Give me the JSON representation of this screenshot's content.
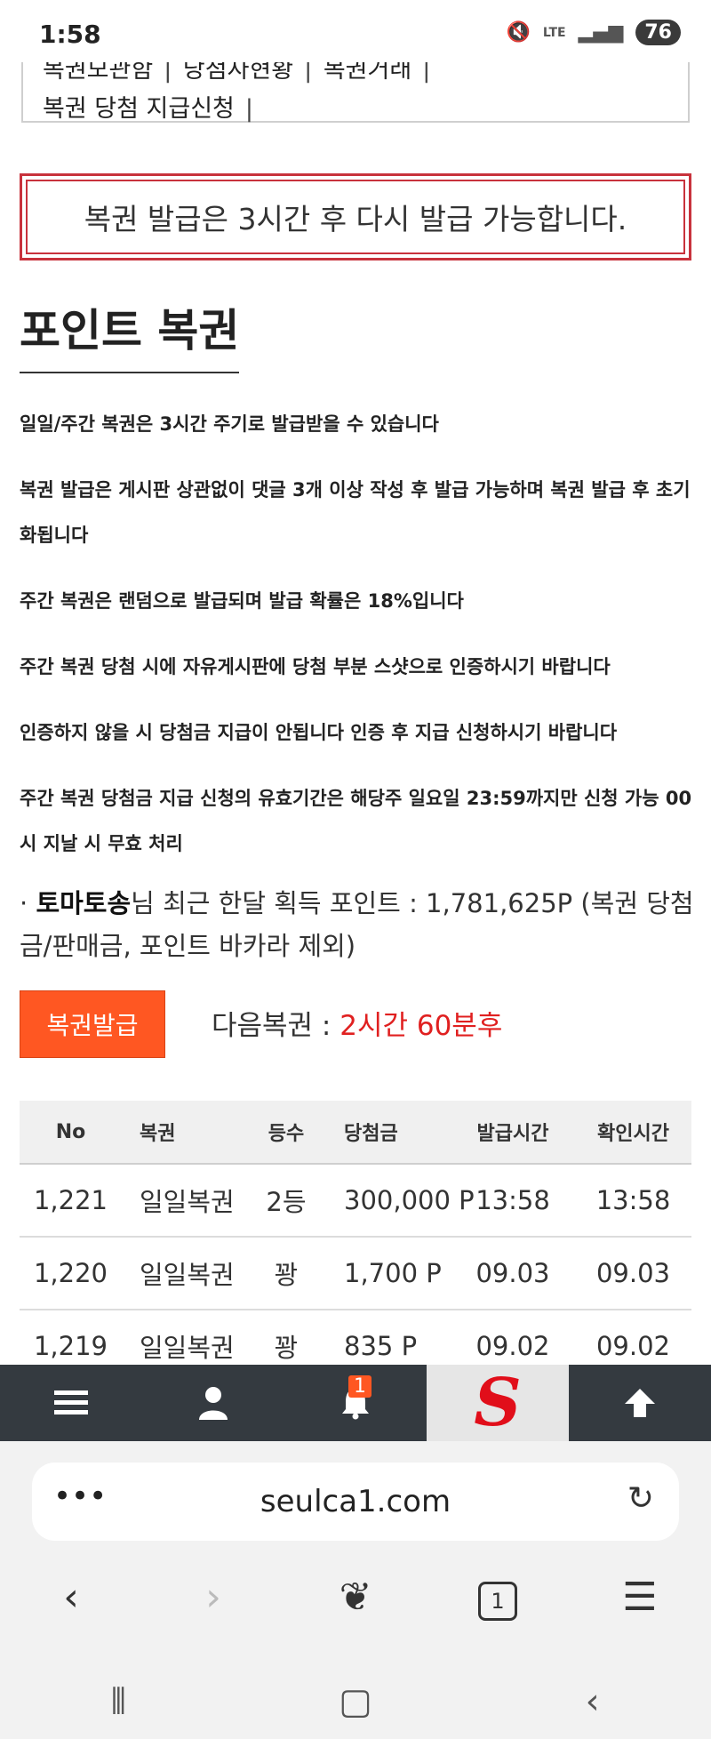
{
  "status_bar": {
    "time": "1:58",
    "network": "LTE",
    "battery": "76"
  },
  "menu": {
    "row1": [
      "복권모관함",
      "당첨자현황",
      "복권거래"
    ],
    "row2": [
      "복권 당첨 지급신청"
    ]
  },
  "notice": {
    "text": "복권 발급은 3시간 후 다시 발급 가능합니다."
  },
  "heading": "포인트 복권",
  "rules": [
    "일일/주간 복권은 3시간 주기로 발급받을 수 있습니다",
    "복권 발급은 게시판 상관없이 댓글 3개 이상 작성 후 발급 가능하며 복권 발급 후 초기화됩니다",
    "주간 복권은 랜덤으로 발급되며 발급 확률은 18%입니다",
    "주간 복권 당첨 시에 자유게시판에 당첨 부분 스샷으로 인증하시기 바랍니다",
    "인증하지 않을 시 당첨금 지급이 안됩니다 인증 후 지급 신청하시기 바랍니다",
    "주간 복권 당첨금 지급 신청의 유효기간은 해당주 일요일 23:59까지만 신청 가능 00시 지날 시 무효 처리"
  ],
  "earnings": {
    "prefix": "· ",
    "user": "토마토송",
    "text": "님 최근 한달 획득 포인트 : 1,781,625P (복권 당첨금/판매금, 포인트 바카라 제외)"
  },
  "issue_button": "복권발급",
  "next_lottery": {
    "label": "다음복권 : ",
    "value": "2시간 60분후"
  },
  "table": {
    "headers": [
      "No",
      "복권",
      "등수",
      "당첨금",
      "발급시간",
      "확인시간"
    ],
    "rows": [
      [
        "1,221",
        "일일복권",
        "2등",
        "300,000 P",
        "13:58",
        "13:58"
      ],
      [
        "1,220",
        "일일복권",
        "꽝",
        "1,700 P",
        "09.03",
        "09.03"
      ],
      [
        "1,219",
        "일일복권",
        "꽝",
        "835 P",
        "09.02",
        "09.02"
      ]
    ]
  },
  "site_nav": {
    "items": [
      "menu-icon",
      "user-icon",
      "bell-icon",
      "site-logo",
      "arrow-up-icon"
    ],
    "notification_count": "1",
    "logo_letter": "S"
  },
  "browser": {
    "url": "seulca1.com",
    "tab_count": "1"
  },
  "colors": {
    "accent": "#ff5722",
    "notice_border": "#c8323c",
    "highlight": "#e02020",
    "nav_bg": "#343a40"
  }
}
